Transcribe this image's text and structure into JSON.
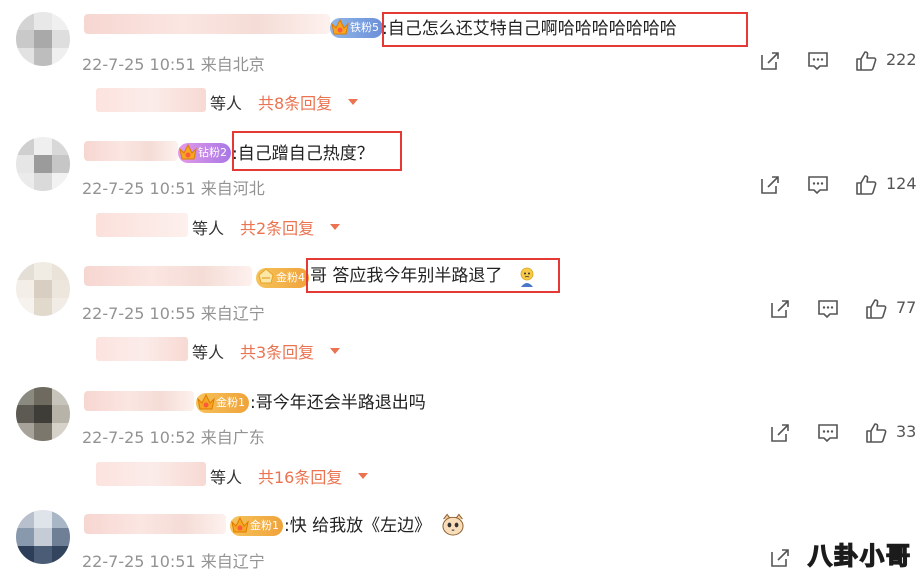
{
  "comments": [
    {
      "badge": "铁粉5",
      "text": ":自己怎么还艾特自己啊哈哈哈哈哈哈哈",
      "time": "22-7-25 10:51",
      "location": "来自北京",
      "likes": "222",
      "reply_prefix": "等人",
      "reply_count": "共8条回复"
    },
    {
      "badge": "钻粉2",
      "text": ":自己蹭自己热度？",
      "time": "22-7-25 10:51",
      "location": "来自河北",
      "likes": "124",
      "reply_prefix": "等人",
      "reply_count": "共2条回复"
    },
    {
      "badge": "金粉4",
      "text": "哥 答应我今年别半路退了",
      "time": "22-7-25 10:55",
      "location": "来自辽宁",
      "likes": "77",
      "reply_prefix": "等人",
      "reply_count": "共3条回复"
    },
    {
      "badge": "金粉1",
      "text": ":哥今年还会半路退出吗",
      "time": "22-7-25 10:52",
      "location": "来自广东",
      "likes": "33",
      "reply_prefix": "等人",
      "reply_count": "共16条回复"
    },
    {
      "badge": "金粉1",
      "text": ":快 给我放《左边》",
      "time": "22-7-25 10:51",
      "location": "来自辽宁"
    }
  ],
  "watermark": "八卦小哥",
  "icons": {
    "share": "share-icon",
    "comment": "comment-icon",
    "like": "thumbs-up-icon",
    "caret": "caret-down-icon"
  },
  "colors": {
    "accent": "#eb7350",
    "highlight": "#e53935",
    "meta": "#939393"
  }
}
